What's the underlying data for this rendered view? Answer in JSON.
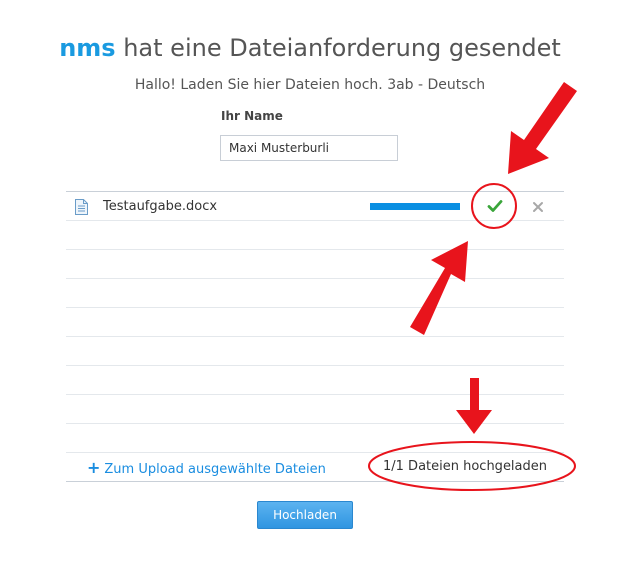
{
  "header": {
    "user": "nms",
    "title_rest": " hat eine Dateianforderung gesendet",
    "subtitle": "Hallo! Laden Sie hier Dateien hoch. 3ab - Deutsch"
  },
  "form": {
    "name_label": "Ihr Name",
    "name_value": "Maxi Musterburli"
  },
  "files": [
    {
      "name": "Testaufgabe.docx",
      "progress": 1.0,
      "status_icon": "check-icon",
      "remove_icon": "close-icon"
    }
  ],
  "footer": {
    "add_plus": "+",
    "add_label": "Zum Upload ausgewählte Dateien",
    "status": "1/1 Dateien hochgeladen"
  },
  "actions": {
    "upload_label": "Hochladen"
  },
  "colors": {
    "accent": "#1a9ae0",
    "progress": "#0a8fe2",
    "success": "#3aa53a",
    "annotation": "#e8141c"
  }
}
